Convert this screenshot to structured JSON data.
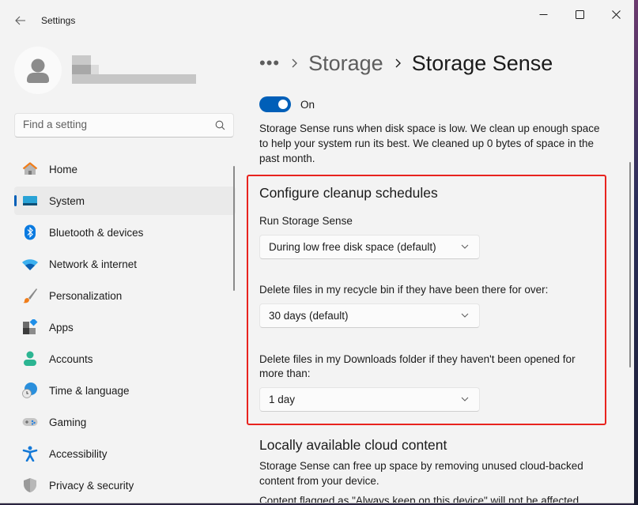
{
  "window": {
    "app_title": "Settings",
    "controls": {
      "minimize": "minimize",
      "maximize": "maximize",
      "close": "close"
    }
  },
  "user": {
    "name_redacted": true
  },
  "search": {
    "placeholder": "Find a setting"
  },
  "sidebar": {
    "items": [
      {
        "label": "Home",
        "icon": "home-icon",
        "selected": false
      },
      {
        "label": "System",
        "icon": "system-icon",
        "selected": true
      },
      {
        "label": "Bluetooth & devices",
        "icon": "bluetooth-icon",
        "selected": false
      },
      {
        "label": "Network & internet",
        "icon": "wifi-icon",
        "selected": false
      },
      {
        "label": "Personalization",
        "icon": "paintbrush-icon",
        "selected": false
      },
      {
        "label": "Apps",
        "icon": "apps-icon",
        "selected": false
      },
      {
        "label": "Accounts",
        "icon": "account-icon",
        "selected": false
      },
      {
        "label": "Time & language",
        "icon": "time-language-icon",
        "selected": false
      },
      {
        "label": "Gaming",
        "icon": "gamepad-icon",
        "selected": false
      },
      {
        "label": "Accessibility",
        "icon": "accessibility-icon",
        "selected": false
      },
      {
        "label": "Privacy & security",
        "icon": "shield-icon",
        "selected": false
      }
    ]
  },
  "breadcrumb": {
    "more": "•••",
    "parent": "Storage",
    "current": "Storage Sense"
  },
  "storage_sense": {
    "toggle_state": "On",
    "toggle_on": true,
    "description": "Storage Sense runs when disk space is low. We clean up enough space to help your system run its best. We cleaned up 0 bytes of space in the past month."
  },
  "cleanup": {
    "title": "Configure cleanup schedules",
    "run_label": "Run Storage Sense",
    "run_value": "During low free disk space (default)",
    "recycle_label": "Delete files in my recycle bin if they have been there for over:",
    "recycle_value": "30 days (default)",
    "downloads_label": "Delete files in my Downloads folder if they haven't been opened for more than:",
    "downloads_value": "1 day"
  },
  "cloud": {
    "title": "Locally available cloud content",
    "description": "Storage Sense can free up space by removing unused cloud-backed content from your device.",
    "cut_off_text": "Content flagged as \"Always keep on this device\" will not be affected."
  },
  "colors": {
    "accent": "#005fb8",
    "highlight_box": "#e8231e",
    "window_bg": "#f3f3f3"
  }
}
